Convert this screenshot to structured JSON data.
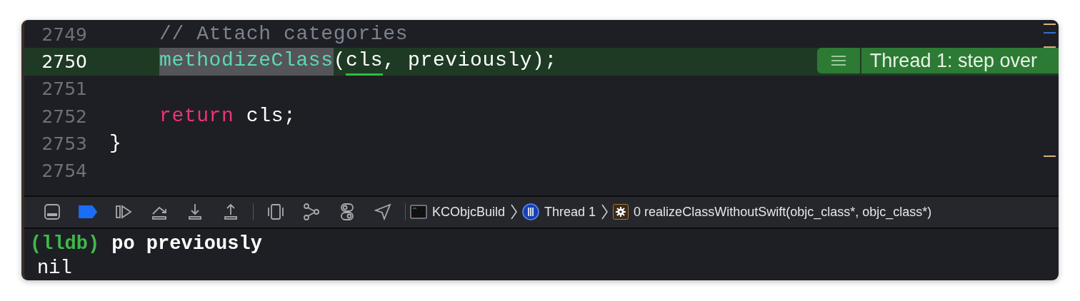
{
  "editor": {
    "lines": [
      {
        "number": "2749",
        "current": false,
        "indent": true,
        "tokens": [
          {
            "text": "// Attach categories",
            "kind": "comment"
          }
        ]
      },
      {
        "number": "2750",
        "current": true,
        "indent": true,
        "tokens": [
          {
            "text": "methodizeClass",
            "kind": "call-highlighted"
          },
          {
            "text": "(",
            "kind": "plain"
          },
          {
            "text": "cls",
            "kind": "underlined"
          },
          {
            "text": ", previously);",
            "kind": "plain"
          }
        ],
        "annotation": "Thread 1: step over"
      },
      {
        "number": "2751",
        "current": false
      },
      {
        "number": "2752",
        "current": false,
        "indent": true,
        "tokens": [
          {
            "text": "return",
            "kind": "keyword"
          },
          {
            "text": " cls;",
            "kind": "plain"
          }
        ]
      },
      {
        "number": "2753",
        "current": false,
        "indent": false,
        "tokens": [
          {
            "text": "}",
            "kind": "plain"
          }
        ]
      },
      {
        "number": "2754",
        "current": false
      }
    ]
  },
  "debug_bar": {
    "breakpoints_active": true,
    "breadcrumbs": [
      {
        "kind": "target",
        "label": "KCObjcBuild"
      },
      {
        "kind": "thread",
        "label": "Thread 1"
      },
      {
        "kind": "frame",
        "label": "0 realizeClassWithoutSwift(objc_class*, objc_class*)"
      }
    ]
  },
  "console": {
    "lines": [
      {
        "kind": "command",
        "prompt": "(lldb)",
        "text": "po previously"
      },
      {
        "kind": "output",
        "text": "nil"
      }
    ]
  }
}
